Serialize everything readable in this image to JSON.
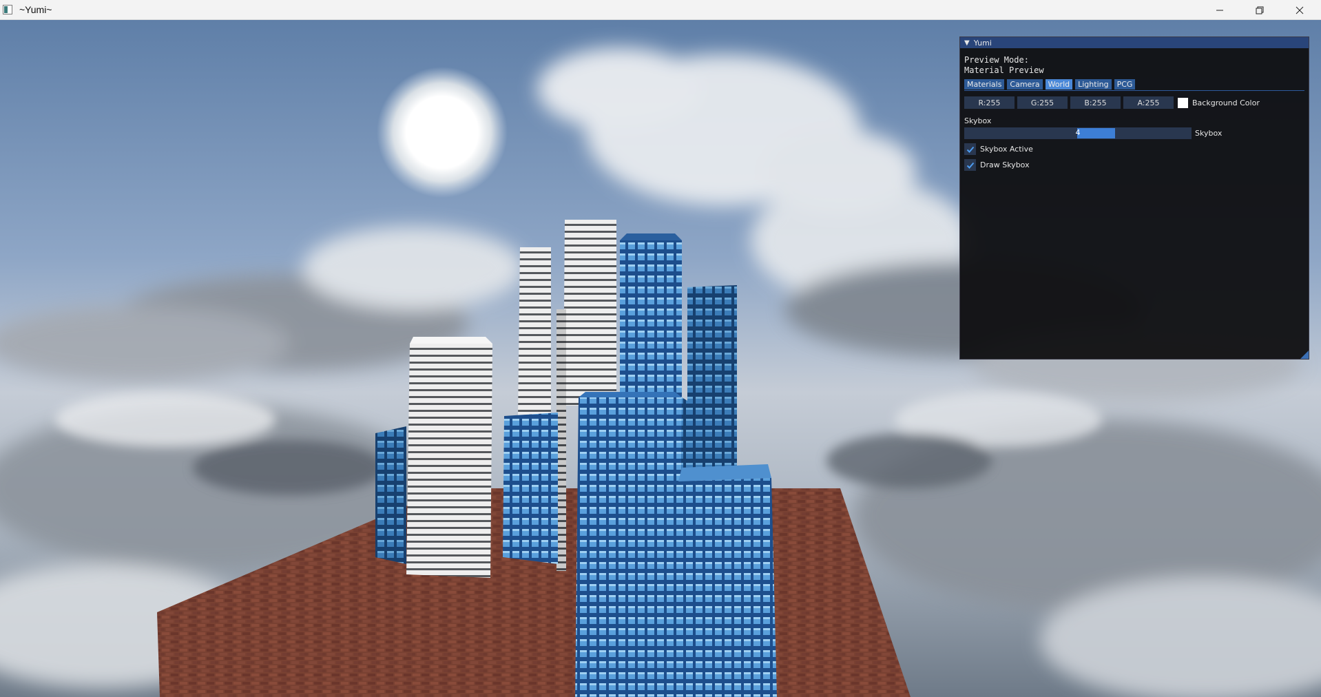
{
  "window": {
    "title": "~Yumi~",
    "icon": "app-icon",
    "controls": [
      "minimize-icon",
      "restore-icon",
      "close-icon"
    ]
  },
  "viewport": {
    "scene": "3d-city-skybox-render",
    "sky_top_color": "#5f7fa8",
    "sky_horizon_color": "#c5ccd6",
    "ground_color": "#8a4a3a"
  },
  "panel": {
    "title": "Yumi",
    "preview_mode_label": "Preview Mode:",
    "preview_mode_value": "Material Preview",
    "tabs": [
      {
        "label": "Materials",
        "active": false
      },
      {
        "label": "Camera",
        "active": false
      },
      {
        "label": "World",
        "active": true
      },
      {
        "label": "Lighting",
        "active": false
      },
      {
        "label": "PCG",
        "active": false
      }
    ],
    "background_color": {
      "r": "R:255",
      "g": "G:255",
      "b": "B:255",
      "a": "A:255",
      "swatch": "#ffffff",
      "label": "Background Color"
    },
    "skybox_section": "Skybox",
    "skybox_slider": {
      "value": "4",
      "label": "Skybox"
    },
    "checkboxes": [
      {
        "label": "Skybox Active",
        "checked": true
      },
      {
        "label": "Draw Skybox",
        "checked": true
      }
    ],
    "accent_color": "#3d7fd6",
    "title_bar_color": "#29457a"
  }
}
